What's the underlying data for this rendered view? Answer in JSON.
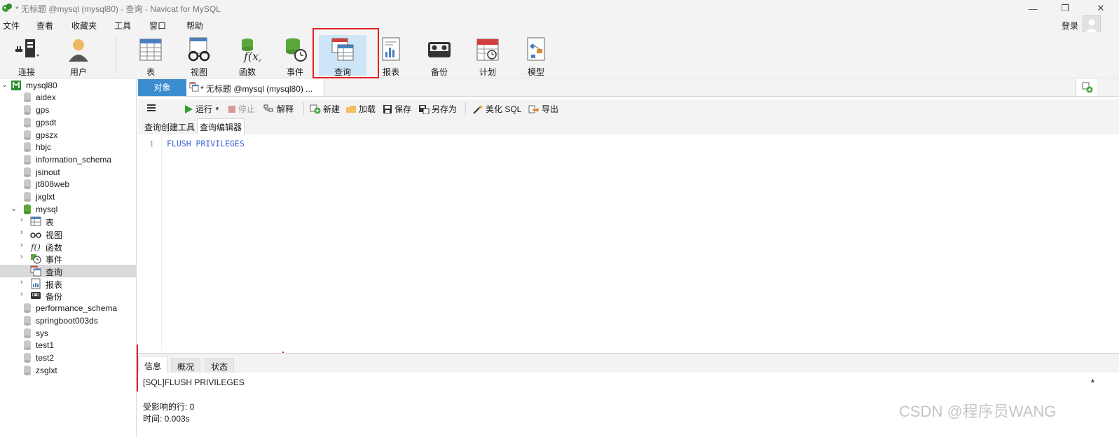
{
  "window": {
    "title": "* 无标题 @mysql (mysql80) - 查询 - Navicat for MySQL",
    "minimize": "—",
    "maximize": "❐",
    "close": "✕"
  },
  "menu": [
    "文件",
    "查看",
    "收藏夹",
    "工具",
    "窗口",
    "帮助"
  ],
  "login_label": "登录",
  "toolbar": {
    "connect": "连接",
    "user": "用户",
    "table": "表",
    "view": "视图",
    "function": "函数",
    "event": "事件",
    "query": "查询",
    "report": "报表",
    "backup": "备份",
    "schedule": "计划",
    "model": "模型"
  },
  "sidebar": {
    "connection": "mysql80",
    "databases_before": [
      "aidex",
      "gps",
      "gpsdt",
      "gpszx",
      "hbjc",
      "information_schema",
      "jsinout",
      "jt808web",
      "jxglxt"
    ],
    "open_db": "mysql",
    "children": [
      "表",
      "视图",
      "函数",
      "事件",
      "查询",
      "报表",
      "备份"
    ],
    "databases_after": [
      "performance_schema",
      "springboot003ds",
      "sys",
      "test1",
      "test2",
      "zsglxt"
    ]
  },
  "tabs": {
    "object": "对象",
    "query_tab": "* 无标题 @mysql (mysql80) ..."
  },
  "query_toolbar": {
    "run": "运行",
    "stop": "停止",
    "explain": "解释",
    "new": "新建",
    "load": "加载",
    "save": "保存",
    "save_as": "另存为",
    "beautify": "美化 SQL",
    "export": "导出"
  },
  "sub_tabs": {
    "builder": "查询创建工具",
    "editor": "查询编辑器"
  },
  "editor": {
    "line_number": "1",
    "code": "FLUSH PRIVILEGES"
  },
  "result_tabs": {
    "info": "信息",
    "overview": "概况",
    "status": "状态"
  },
  "result": {
    "sql": "[SQL]FLUSH PRIVILEGES",
    "affected_rows": "受影响的行: 0",
    "time": "时间: 0.003s"
  },
  "watermark": "CSDN @程序员WANG",
  "colors": {
    "accent": "#3c8dcf",
    "highlight": "#e02020",
    "active_tool": "#cde6f7",
    "selected_row": "#d9d9d9",
    "code": "#3a5fd8"
  }
}
